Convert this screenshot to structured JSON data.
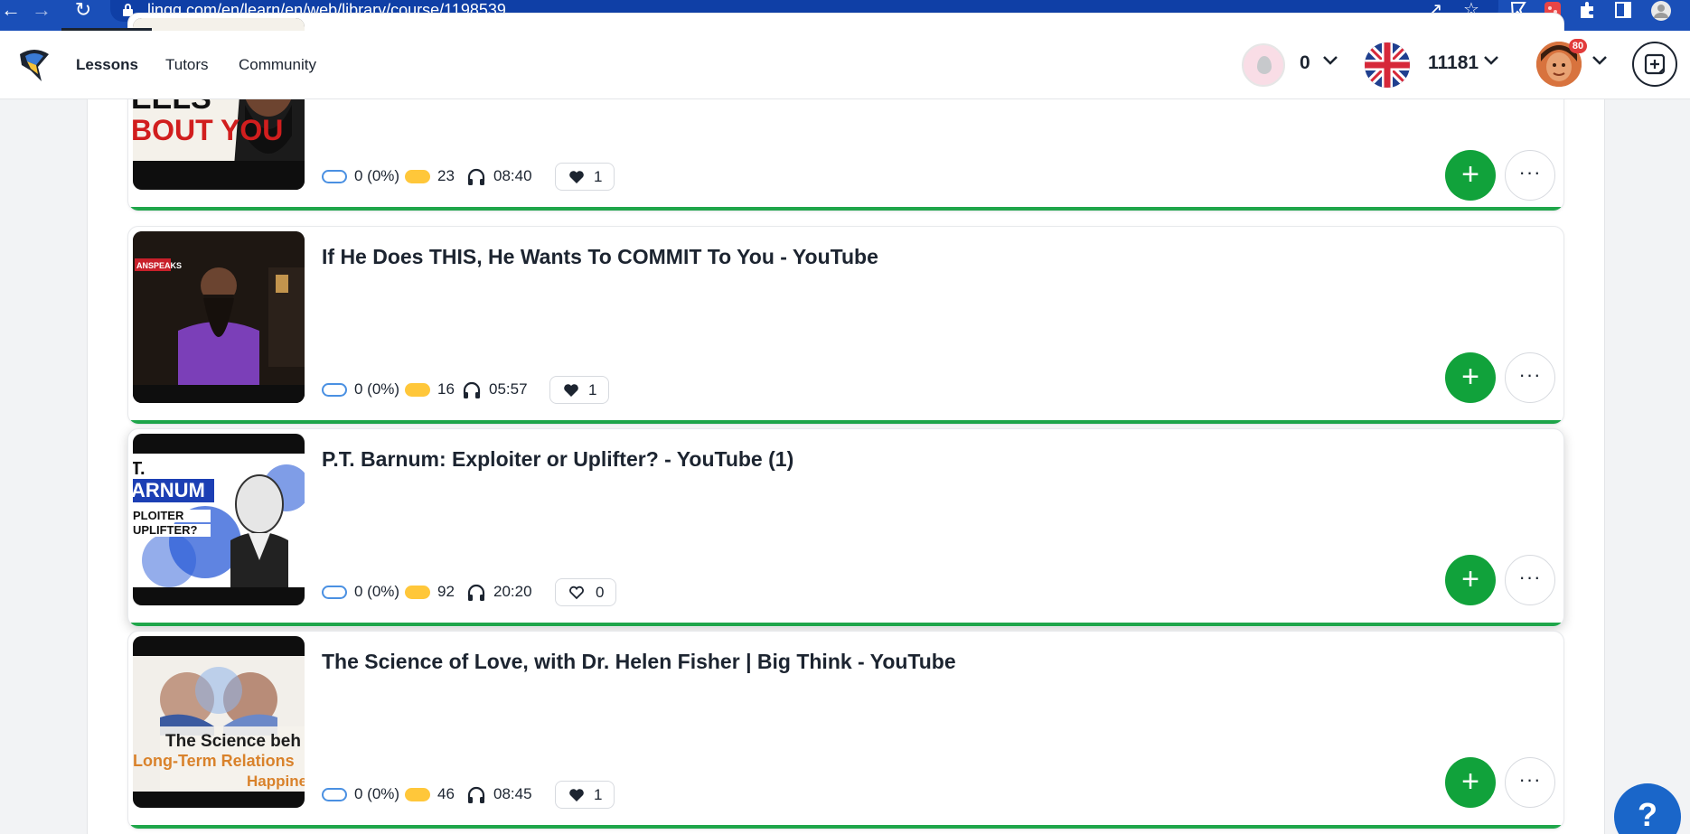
{
  "browser": {
    "url": "lingq.com/en/learn/en/web/library/course/1198539",
    "icons": [
      "back-icon",
      "forward-icon",
      "reload-icon",
      "lock-icon",
      "share-icon",
      "star-icon",
      "extension-icon",
      "puzzle-icon",
      "sidepanel-icon",
      "profile-icon"
    ]
  },
  "header": {
    "nav": [
      {
        "label": "Lessons",
        "active": true
      },
      {
        "label": "Tutors",
        "active": false
      },
      {
        "label": "Community",
        "active": false
      }
    ],
    "streak_count": "0",
    "language_known_words": "11181",
    "notification_count": "80"
  },
  "lessons": [
    {
      "title": "",
      "thumb_text": [
        "EELS",
        "BOUT YOU"
      ],
      "lingqs": "0 (0%)",
      "new_words": "23",
      "duration": "08:40",
      "likes": "1",
      "liked": true
    },
    {
      "title": "If He Does THIS, He Wants To COMMIT To You - YouTube",
      "thumb_text": [
        "ANSPEAKS"
      ],
      "lingqs": "0 (0%)",
      "new_words": "16",
      "duration": "05:57",
      "likes": "1",
      "liked": true
    },
    {
      "title": "P.T. Barnum: Exploiter or Uplifter? - YouTube (1)",
      "thumb_text": [
        "T.",
        "ARNUM",
        "PLOITER",
        "UPLIFTER?"
      ],
      "lingqs": "0 (0%)",
      "new_words": "92",
      "duration": "20:20",
      "likes": "0",
      "liked": false
    },
    {
      "title": "The Science of Love, with Dr. Helen Fisher | Big Think - YouTube",
      "thumb_text": [
        "The Science beh",
        "Long-Term Relations",
        "Happine"
      ],
      "lingqs": "0 (0%)",
      "new_words": "46",
      "duration": "08:45",
      "likes": "1",
      "liked": true
    }
  ],
  "buttons": {
    "add_label": "+",
    "more_label": "···",
    "help_label": "?"
  },
  "colors": {
    "browser_blue": "#1a4fb8",
    "accent_green": "#11a23b",
    "progress_green": "#1fa64a",
    "known_pill": "#ffc73a",
    "lingq_pill_border": "#4a90e2",
    "help_blue": "#1a66c9"
  }
}
